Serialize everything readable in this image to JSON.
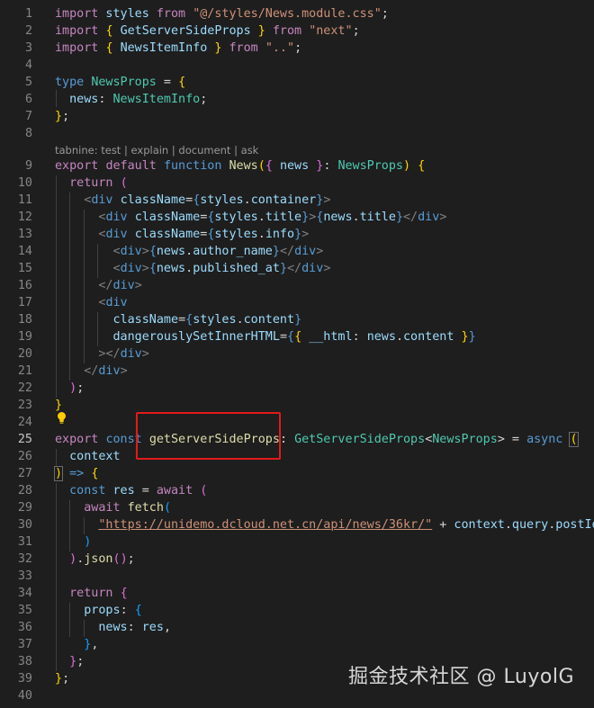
{
  "codelens": {
    "prefix": "tabnine:",
    "items": [
      "test",
      "explain",
      "document",
      "ask"
    ],
    "separator": "|"
  },
  "editor": {
    "line_numbers": [
      "1",
      "2",
      "3",
      "4",
      "5",
      "6",
      "7",
      "8",
      "9",
      "10",
      "11",
      "12",
      "13",
      "14",
      "15",
      "16",
      "17",
      "18",
      "19",
      "20",
      "21",
      "22",
      "23",
      "24",
      "25",
      "26",
      "27",
      "28",
      "29",
      "30",
      "31",
      "32",
      "33",
      "34",
      "35",
      "36",
      "37",
      "38",
      "39",
      "40"
    ],
    "current_line": "25",
    "tokens": {
      "t1": [
        "import",
        " styles ",
        "from",
        " ",
        "\"@/styles/News.module.css\"",
        ";"
      ],
      "t2": [
        "import",
        " ",
        "{",
        " ",
        "GetServerSideProps",
        " ",
        "}",
        " ",
        "from",
        " ",
        "\"next\"",
        ";"
      ],
      "t3": [
        "import",
        " ",
        "{",
        " ",
        "NewsItemInfo",
        " ",
        "}",
        " ",
        "from",
        " ",
        "\"..\"",
        ";"
      ],
      "t5": [
        "type",
        " ",
        "NewsProps",
        " = ",
        "{"
      ],
      "t6": [
        "  ",
        "news",
        ": ",
        "NewsItemInfo",
        ";"
      ],
      "t7": [
        "}",
        ";"
      ],
      "t9": [
        "export",
        " ",
        "default",
        " ",
        "function",
        " ",
        "News",
        "(",
        "{",
        " ",
        "news",
        " ",
        "}",
        ": ",
        "NewsProps",
        ") ",
        "{"
      ],
      "t10": [
        "  ",
        "return",
        " ",
        "("
      ],
      "t11": [
        "    ",
        "<",
        "div",
        " ",
        "className",
        "=",
        "{",
        "styles",
        ".",
        "container",
        "}",
        ">"
      ],
      "t12": [
        "      ",
        "<",
        "div",
        " ",
        "className",
        "=",
        "{",
        "styles",
        ".",
        "title",
        "}",
        ">",
        "{",
        "news",
        ".",
        "title",
        "}",
        "</",
        "div",
        ">"
      ],
      "t13": [
        "      ",
        "<",
        "div",
        " ",
        "className",
        "=",
        "{",
        "styles",
        ".",
        "info",
        "}",
        ">"
      ],
      "t14": [
        "        ",
        "<",
        "div",
        ">",
        "{",
        "news",
        ".",
        "author_name",
        "}",
        "</",
        "div",
        ">"
      ],
      "t15": [
        "        ",
        "<",
        "div",
        ">",
        "{",
        "news",
        ".",
        "published_at",
        "}",
        "</",
        "div",
        ">"
      ],
      "t16": [
        "      ",
        "</",
        "div",
        ">"
      ],
      "t17": [
        "      ",
        "<",
        "div"
      ],
      "t18": [
        "        ",
        "className",
        "=",
        "{",
        "styles",
        ".",
        "content",
        "}"
      ],
      "t19": [
        "        ",
        "dangerouslySetInnerHTML",
        "=",
        "{",
        "{",
        " ",
        "__html",
        ": ",
        "news",
        ".",
        "content",
        " ",
        "}",
        "}"
      ],
      "t20": [
        "      ",
        ">",
        "</",
        "div",
        ">"
      ],
      "t21": [
        "    ",
        "</",
        "div",
        ">"
      ],
      "t22": [
        "  ",
        ")",
        ";"
      ],
      "t23": [
        "}"
      ],
      "t25": [
        "export",
        " ",
        "const",
        " ",
        "getServerSideProps",
        ": ",
        "GetServerSideProps",
        "<",
        "NewsProps",
        "> = ",
        "async",
        " ",
        "("
      ],
      "t26": [
        "  ",
        "context"
      ],
      "t27": [
        ")",
        " ",
        "=>",
        " ",
        "{"
      ],
      "t28": [
        "  ",
        "const",
        " ",
        "res",
        " = ",
        "await",
        " ",
        "("
      ],
      "t29": [
        "    ",
        "await",
        " ",
        "fetch",
        "("
      ],
      "t30": [
        "      ",
        "\"https://unidemo.dcloud.net.cn/api/news/36kr/\"",
        " + ",
        "context",
        ".",
        "query",
        ".",
        "postId"
      ],
      "t31": [
        "    ",
        ")"
      ],
      "t32": [
        "  ",
        ")",
        ".",
        "json",
        "(",
        ")",
        ";"
      ],
      "t34": [
        "  ",
        "return",
        " ",
        "{"
      ],
      "t35": [
        "    ",
        "props",
        ": ",
        "{"
      ],
      "t36": [
        "      ",
        "news",
        ": ",
        "res",
        ","
      ],
      "t37": [
        "    ",
        "}",
        ","
      ],
      "t38": [
        "  ",
        "}",
        ";"
      ],
      "t39": [
        "}",
        ";"
      ]
    }
  },
  "watermark": "掘金技术社区 @ LuyolG",
  "colors": {
    "background": "#1e1e1e",
    "keyword": "#569cd6",
    "control": "#c586c0",
    "string": "#ce9178",
    "type": "#4ec9b0",
    "function": "#dcdcaa",
    "variable": "#9cdcfe",
    "highlight_box": "#e21a1a"
  }
}
